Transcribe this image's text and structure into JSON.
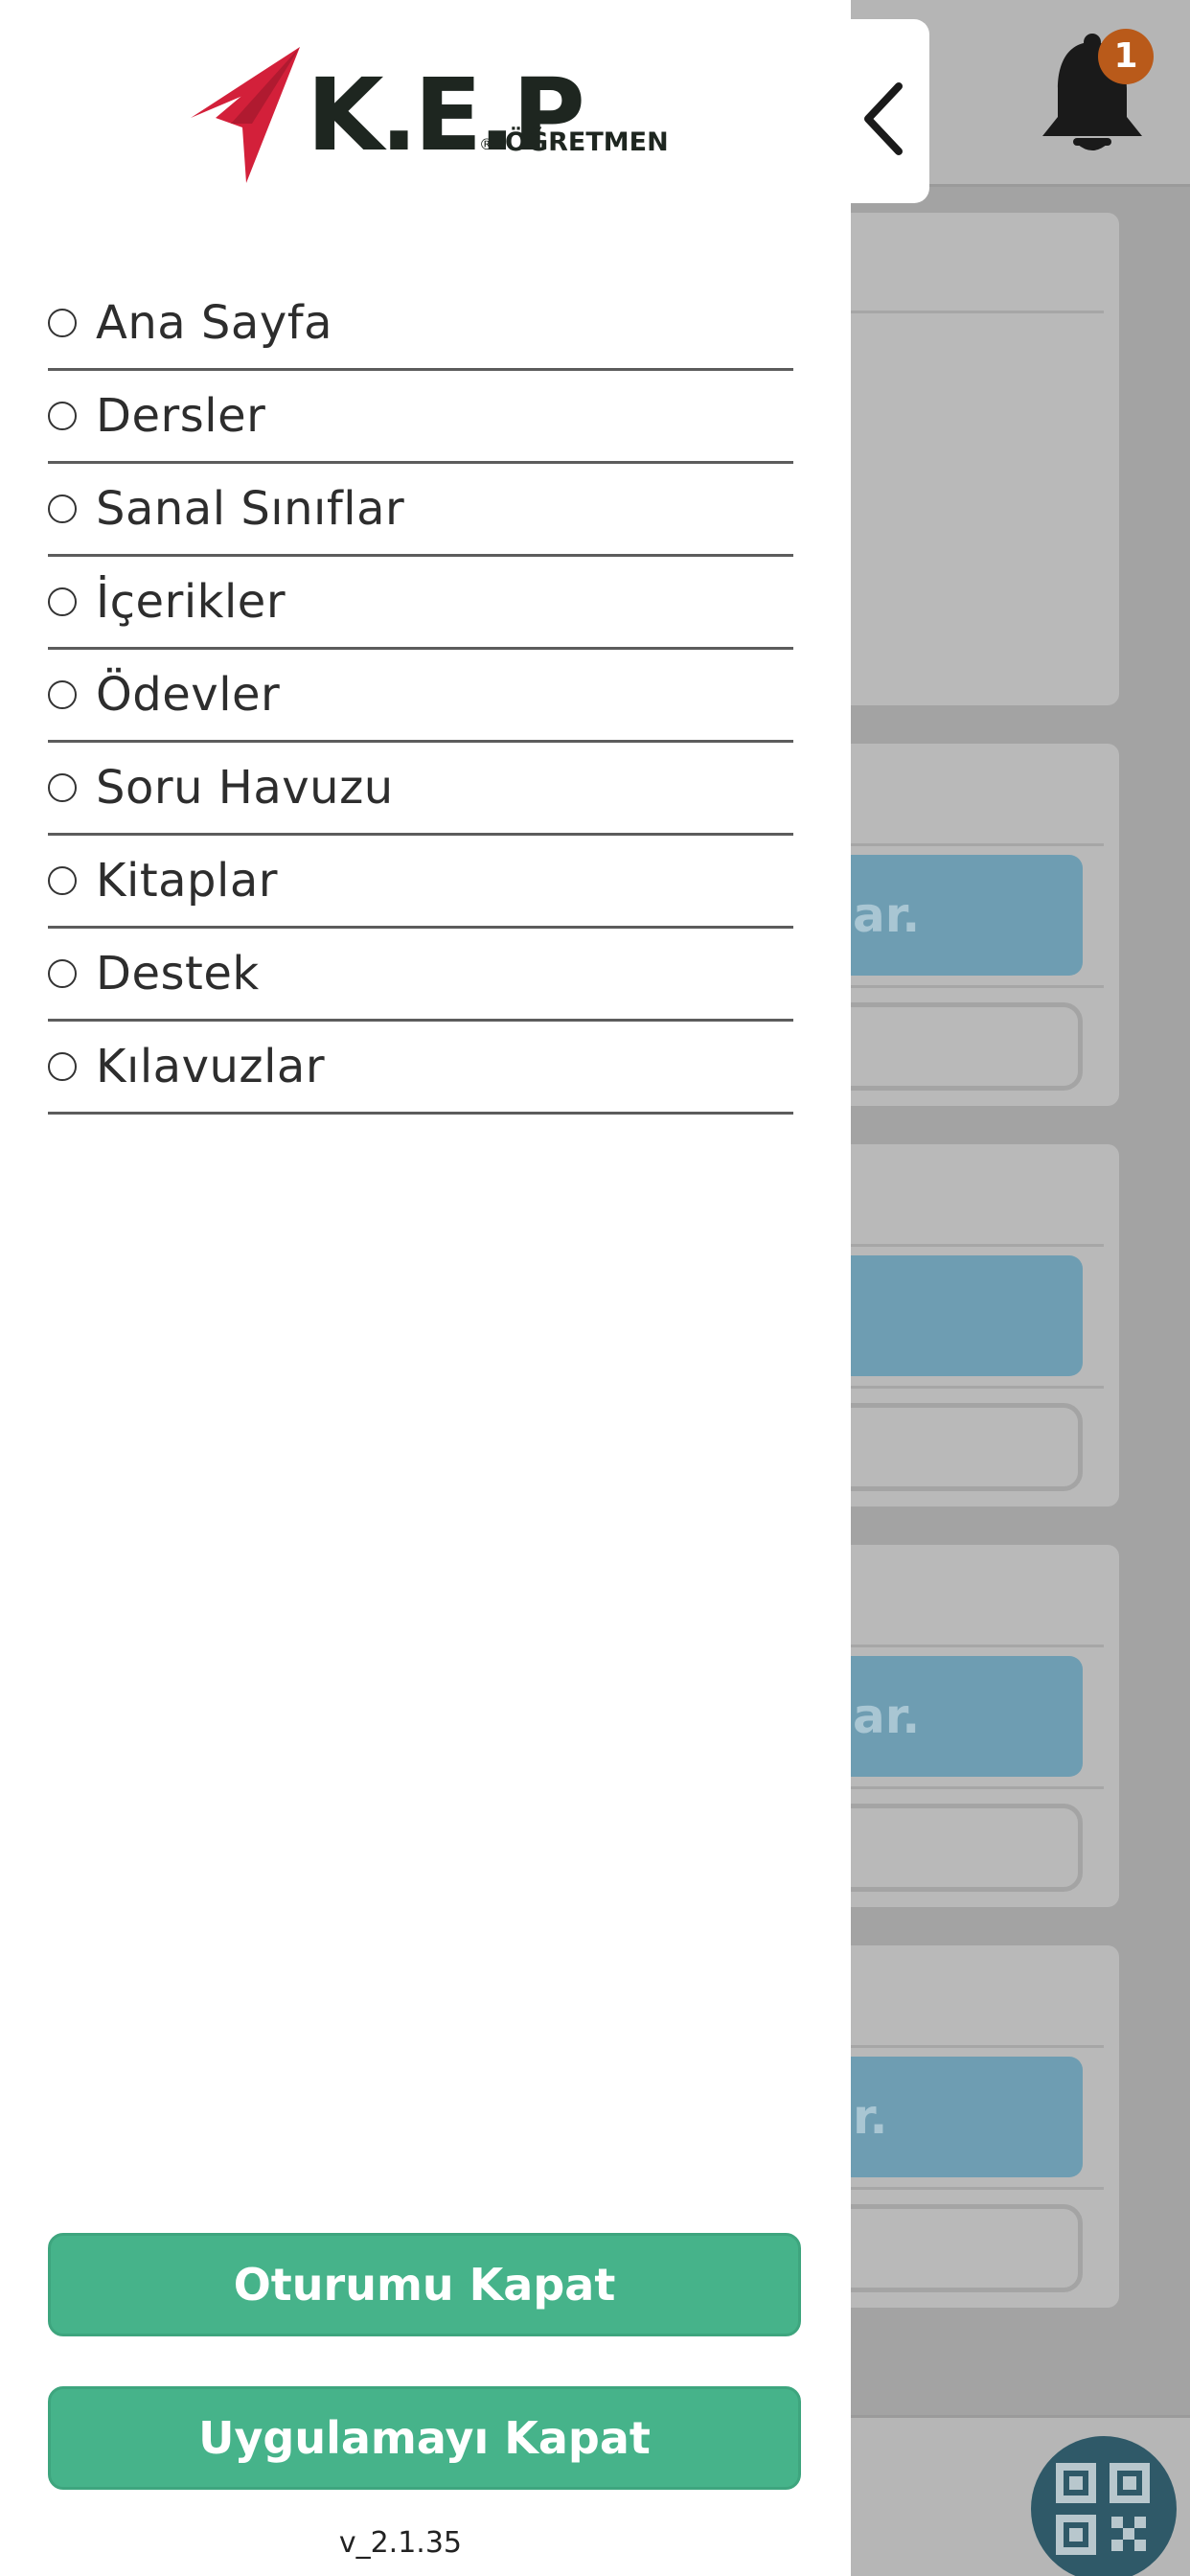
{
  "drawer": {
    "logo": {
      "brand": "K.E.P",
      "registered": "®",
      "subtitle": "ÖĞRETMEN"
    },
    "menu": [
      {
        "label": "Ana Sayfa"
      },
      {
        "label": "Dersler"
      },
      {
        "label": "Sanal Sınıflar"
      },
      {
        "label": "İçerikler"
      },
      {
        "label": "Ödevler"
      },
      {
        "label": "Soru Havuzu"
      },
      {
        "label": "Kitaplar"
      },
      {
        "label": "Destek"
      },
      {
        "label": "Kılavuzlar"
      }
    ],
    "buttons": {
      "logout": "Oturumu Kapat",
      "exit_app": "Uygulamayı Kapat"
    },
    "version": "v_2.1.35"
  },
  "background": {
    "notification_count": "1",
    "card_button_fragments": [
      "ar.",
      "",
      "ar.",
      "r."
    ]
  },
  "colors": {
    "accent_green": "#46b38a",
    "logo_red": "#d3203a",
    "badge_orange": "#b95a1a"
  },
  "icons": [
    "back-chevron-icon",
    "bell-icon",
    "qr-code-icon",
    "radio-icon"
  ]
}
